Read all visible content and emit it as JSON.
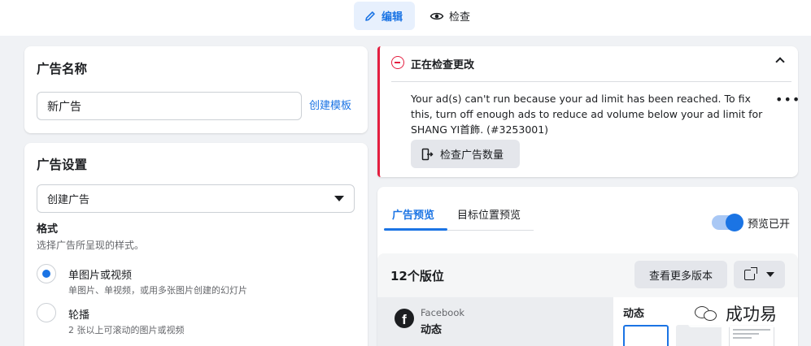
{
  "topbar": {
    "edit_label": "编辑",
    "review_label": "检查"
  },
  "ad_name": {
    "title": "广告名称",
    "value": "新广告",
    "create_template": "创建模板"
  },
  "ad_settings": {
    "title": "广告设置",
    "dropdown_value": "创建广告",
    "format_label": "格式",
    "format_desc": "选择广告所呈现的样式。",
    "options": [
      {
        "title": "单图片或视频",
        "desc": "单图片、单视频，或用多张图片创建的幻灯片",
        "checked": true
      },
      {
        "title": "轮播",
        "desc": "2 张以上可滚动的图片或视频",
        "checked": false
      }
    ]
  },
  "review_alert": {
    "title": "正在检查更改",
    "message": "Your ad(s) can't run because your ad limit has been reached. To fix this, turn off enough ads to reduce ad volume below your ad limit for SHANG YI首飾. (#3253001)",
    "more": "•••",
    "button_label": "检查广告数量",
    "accent": "#e41e3f"
  },
  "preview": {
    "tabs": [
      {
        "label": "广告预览",
        "active": true
      },
      {
        "label": "目标位置预览",
        "active": false
      }
    ],
    "toggle_label": "预览已开",
    "toggle_on": true,
    "placements_title": "12个版位",
    "more_versions_label": "查看更多版本",
    "platform_name": "Facebook",
    "platform_placement": "动态",
    "feed_title": "动态",
    "fb_logo_letter": "f"
  },
  "watermark": {
    "text": "成功易"
  },
  "colors": {
    "accent": "#1b74e4",
    "background": "#f0f2f5"
  }
}
